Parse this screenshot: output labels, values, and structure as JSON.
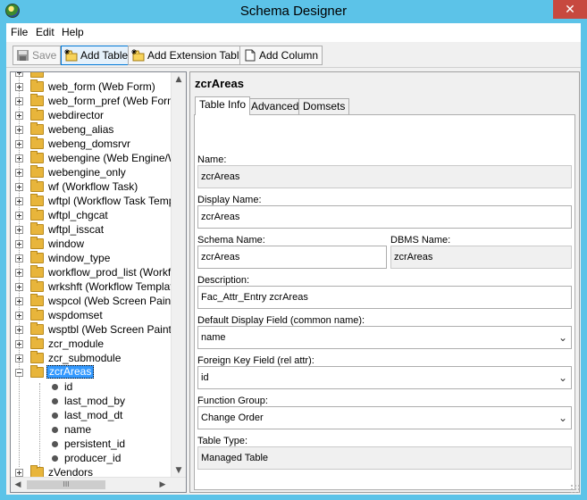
{
  "window": {
    "title": "Schema Designer",
    "close": "✕"
  },
  "menu": [
    "File",
    "Edit",
    "Help"
  ],
  "toolbar": {
    "save": "Save",
    "add_table": "Add Table",
    "add_extension_table": "Add Extension Table",
    "add_column": "Add Column"
  },
  "tree": {
    "items": [
      "web_form (Web Form)",
      "web_form_pref (Web Form Pr",
      "webdirector",
      "webeng_alias",
      "webeng_domsrvr",
      "webengine (Web Engine/Web",
      "webengine_only",
      "wf (Workflow Task)",
      "wftpl (Workflow Task Templat",
      "wftpl_chgcat",
      "wftpl_isscat",
      "window",
      "window_type",
      "workflow_prod_list (Workflow",
      "wrkshft (Workflow Template V",
      "wspcol (Web Screen Painter C",
      "wspdomset",
      "wsptbl (Web Screen Painter T",
      "zcr_module",
      "zcr_submodule"
    ],
    "selected": "zcrAreas",
    "children": [
      "id",
      "last_mod_by",
      "last_mod_dt",
      "name",
      "persistent_id",
      "producer_id"
    ],
    "after": [
      "zVendors"
    ],
    "hscroll_thumb": "III"
  },
  "panel": {
    "title": "zcrAreas",
    "tabs": [
      "Table Info",
      "Advanced",
      "Domsets"
    ],
    "fields": {
      "name_label": "Name:",
      "name_value": "zcrAreas",
      "display_name_label": "Display Name:",
      "display_name_value": "zcrAreas",
      "schema_name_label": "Schema Name:",
      "schema_name_value": "zcrAreas",
      "dbms_name_label": "DBMS Name:",
      "dbms_name_value": "zcrAreas",
      "description_label": "Description:",
      "description_value": "Fac_Attr_Entry zcrAreas",
      "default_display_label": "Default Display Field (common name):",
      "default_display_value": "name",
      "foreign_key_label": "Foreign Key Field (rel attr):",
      "foreign_key_value": "id",
      "function_group_label": "Function Group:",
      "function_group_value": "Change Order",
      "table_type_label": "Table Type:",
      "table_type_value": "Managed Table"
    }
  },
  "colors": {
    "titlebar": "#5cc3e8",
    "selection": "#3399ff",
    "folder": "#e8b53b",
    "close": "#c7493f"
  }
}
